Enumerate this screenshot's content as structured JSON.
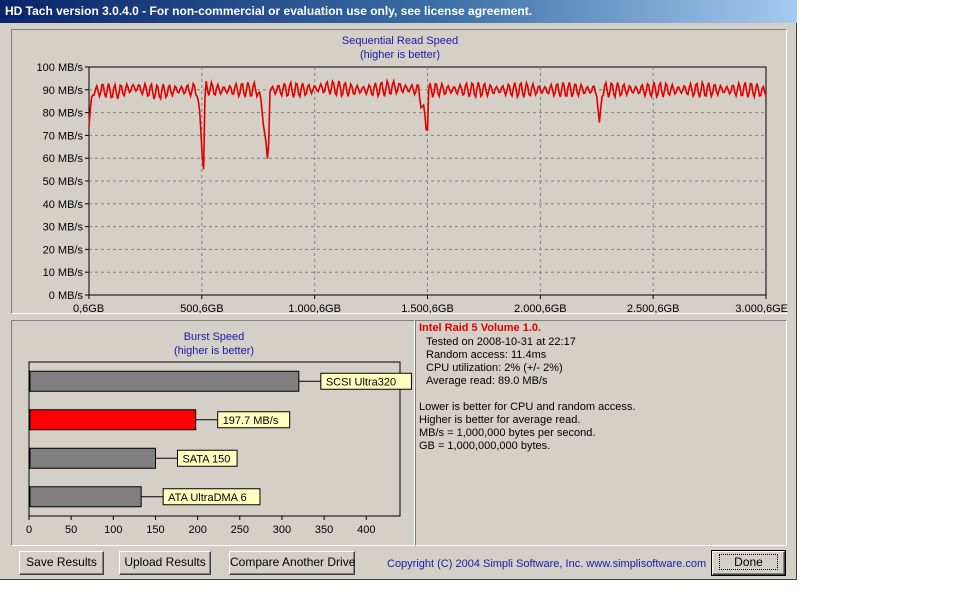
{
  "window": {
    "title": "HD Tach version 3.0.4.0  - For non-commercial or evaluation use only, see license agreement."
  },
  "read_chart": {
    "title_line1": "Sequential Read Speed",
    "title_line2": "(higher is better)",
    "y_ticks": [
      "0 MB/s",
      "10 MB/s",
      "20 MB/s",
      "30 MB/s",
      "40 MB/s",
      "50 MB/s",
      "60 MB/s",
      "70 MB/s",
      "80 MB/s",
      "90 MB/s",
      "100 MB/s"
    ],
    "x_ticks": [
      "0,6GB",
      "500,6GB",
      "1.000,6GB",
      "1.500,6GB",
      "2.000,6GB",
      "2.500,6GB",
      "3.000,6GE"
    ],
    "line_color": "#e00000"
  },
  "burst_chart": {
    "title_line1": "Burst Speed",
    "title_line2": "(higher is better)",
    "x_ticks": [
      "0",
      "50",
      "100",
      "150",
      "200",
      "250",
      "300",
      "350",
      "400"
    ],
    "bars": [
      {
        "label": "SCSI Ultra320",
        "value": 320,
        "color": "#808080"
      },
      {
        "label": "197.7 MB/s",
        "value": 197.7,
        "color": "#ff0000"
      },
      {
        "label": "SATA 150",
        "value": 150,
        "color": "#808080"
      },
      {
        "label": "ATA UltraDMA 6",
        "value": 133,
        "color": "#808080"
      }
    ]
  },
  "chart_data": [
    {
      "type": "line",
      "title": "Sequential Read Speed (higher is better)",
      "xlabel": "",
      "ylabel": "",
      "ylim": [
        0,
        100
      ],
      "xlim": [
        0.6,
        3000.6
      ],
      "x_unit": "GB",
      "y_unit": "MB/s",
      "series": [
        {
          "x": [
            0.6,
            15,
            60,
            120,
            200,
            300,
            400,
            480,
            510,
            515,
            520,
            560,
            640,
            750,
            770,
            790,
            795,
            800,
            860,
            960,
            1060,
            1160,
            1260,
            1360,
            1460,
            1500,
            1505,
            1515,
            1600,
            1700,
            1800,
            1900,
            2000,
            2100,
            2200,
            2250,
            2265,
            2270,
            2280,
            2350,
            2450,
            2550,
            2650,
            2750,
            2850,
            2950,
            3000.6
          ],
          "y": [
            74,
            89,
            90,
            89,
            91,
            89,
            90,
            90,
            55,
            90,
            91,
            90,
            90,
            90,
            80,
            60,
            56,
            90,
            90,
            90,
            91,
            90,
            90,
            91,
            90,
            73,
            89,
            90,
            90,
            90,
            90,
            90,
            90,
            90,
            90,
            90,
            69,
            89,
            90,
            90,
            90,
            90,
            90,
            90,
            90,
            90,
            89
          ]
        }
      ]
    },
    {
      "type": "bar",
      "title": "Burst Speed (higher is better)",
      "categories": [
        "SCSI Ultra320",
        "197.7 MB/s",
        "SATA 150",
        "ATA UltraDMA 6"
      ],
      "values": [
        320,
        197.7,
        150,
        133
      ],
      "xlim": [
        0,
        440
      ]
    }
  ],
  "info": {
    "drive_name": "Intel Raid 5 Volume 1.0.",
    "tested_on": "Tested on 2008-10-31 at 22:17",
    "random_access": "Random access: 11.4ms",
    "cpu": "CPU utilization: 2% (+/- 2%)",
    "avg_read": "Average read: 89.0 MB/s",
    "note1": "Lower is better for CPU and random access.",
    "note2": "Higher is better for average read.",
    "note3": "MB/s = 1,000,000 bytes per second.",
    "note4": "GB = 1,000,000,000 bytes."
  },
  "buttons": {
    "save": "Save Results",
    "upload": "Upload Results",
    "compare": "Compare Another Drive",
    "done": "Done"
  },
  "copyright": "Copyright (C) 2004 Simpli Software, Inc. www.simplisoftware.com"
}
